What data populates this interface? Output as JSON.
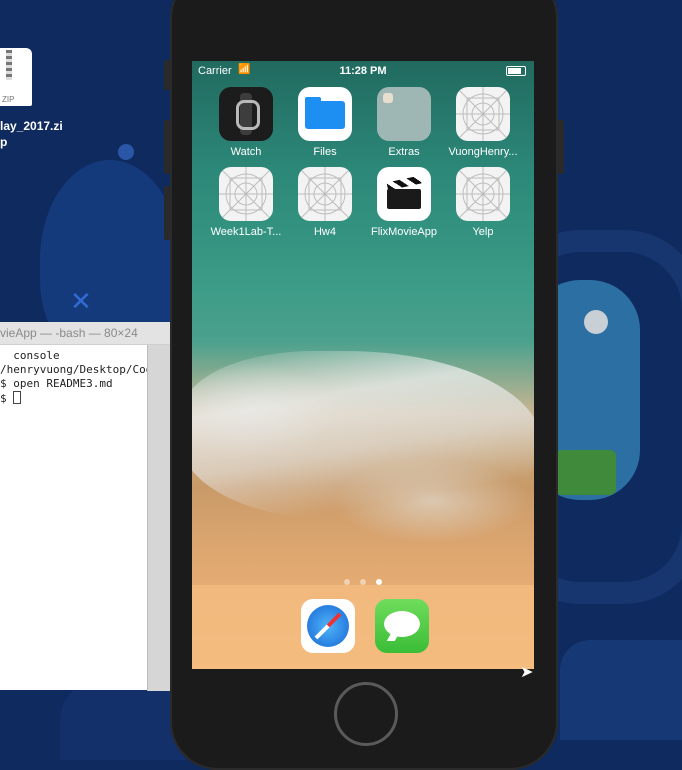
{
  "desktop": {
    "zip_file": {
      "type_label": "ZIP",
      "name_line1": "lay_2017.zi",
      "name_line2": "p"
    }
  },
  "terminal": {
    "title": "vieApp — -bash — 80×24",
    "lines": [
      "  console",
      "/henryvuong/Desktop/Code",
      "$ open README3.md",
      "$ "
    ]
  },
  "simulator": {
    "statusbar": {
      "carrier": "Carrier",
      "time": "11:28 PM"
    },
    "home_apps": [
      {
        "label": "Watch",
        "icon": "watch-icon"
      },
      {
        "label": "Files",
        "icon": "files-icon"
      },
      {
        "label": "Extras",
        "icon": "extras-folder-icon"
      },
      {
        "label": "VuongHenry...",
        "icon": "blank-app-icon"
      },
      {
        "label": "Week1Lab-T...",
        "icon": "blank-app-icon"
      },
      {
        "label": "Hw4",
        "icon": "blank-app-icon"
      },
      {
        "label": "FlixMovieApp",
        "icon": "clapperboard-icon"
      },
      {
        "label": "Yelp",
        "icon": "blank-app-icon"
      }
    ],
    "page_dots": 3,
    "active_page": 3,
    "dock": [
      {
        "label": "Safari",
        "icon": "safari-icon"
      },
      {
        "label": "Messages",
        "icon": "messages-icon"
      }
    ]
  }
}
